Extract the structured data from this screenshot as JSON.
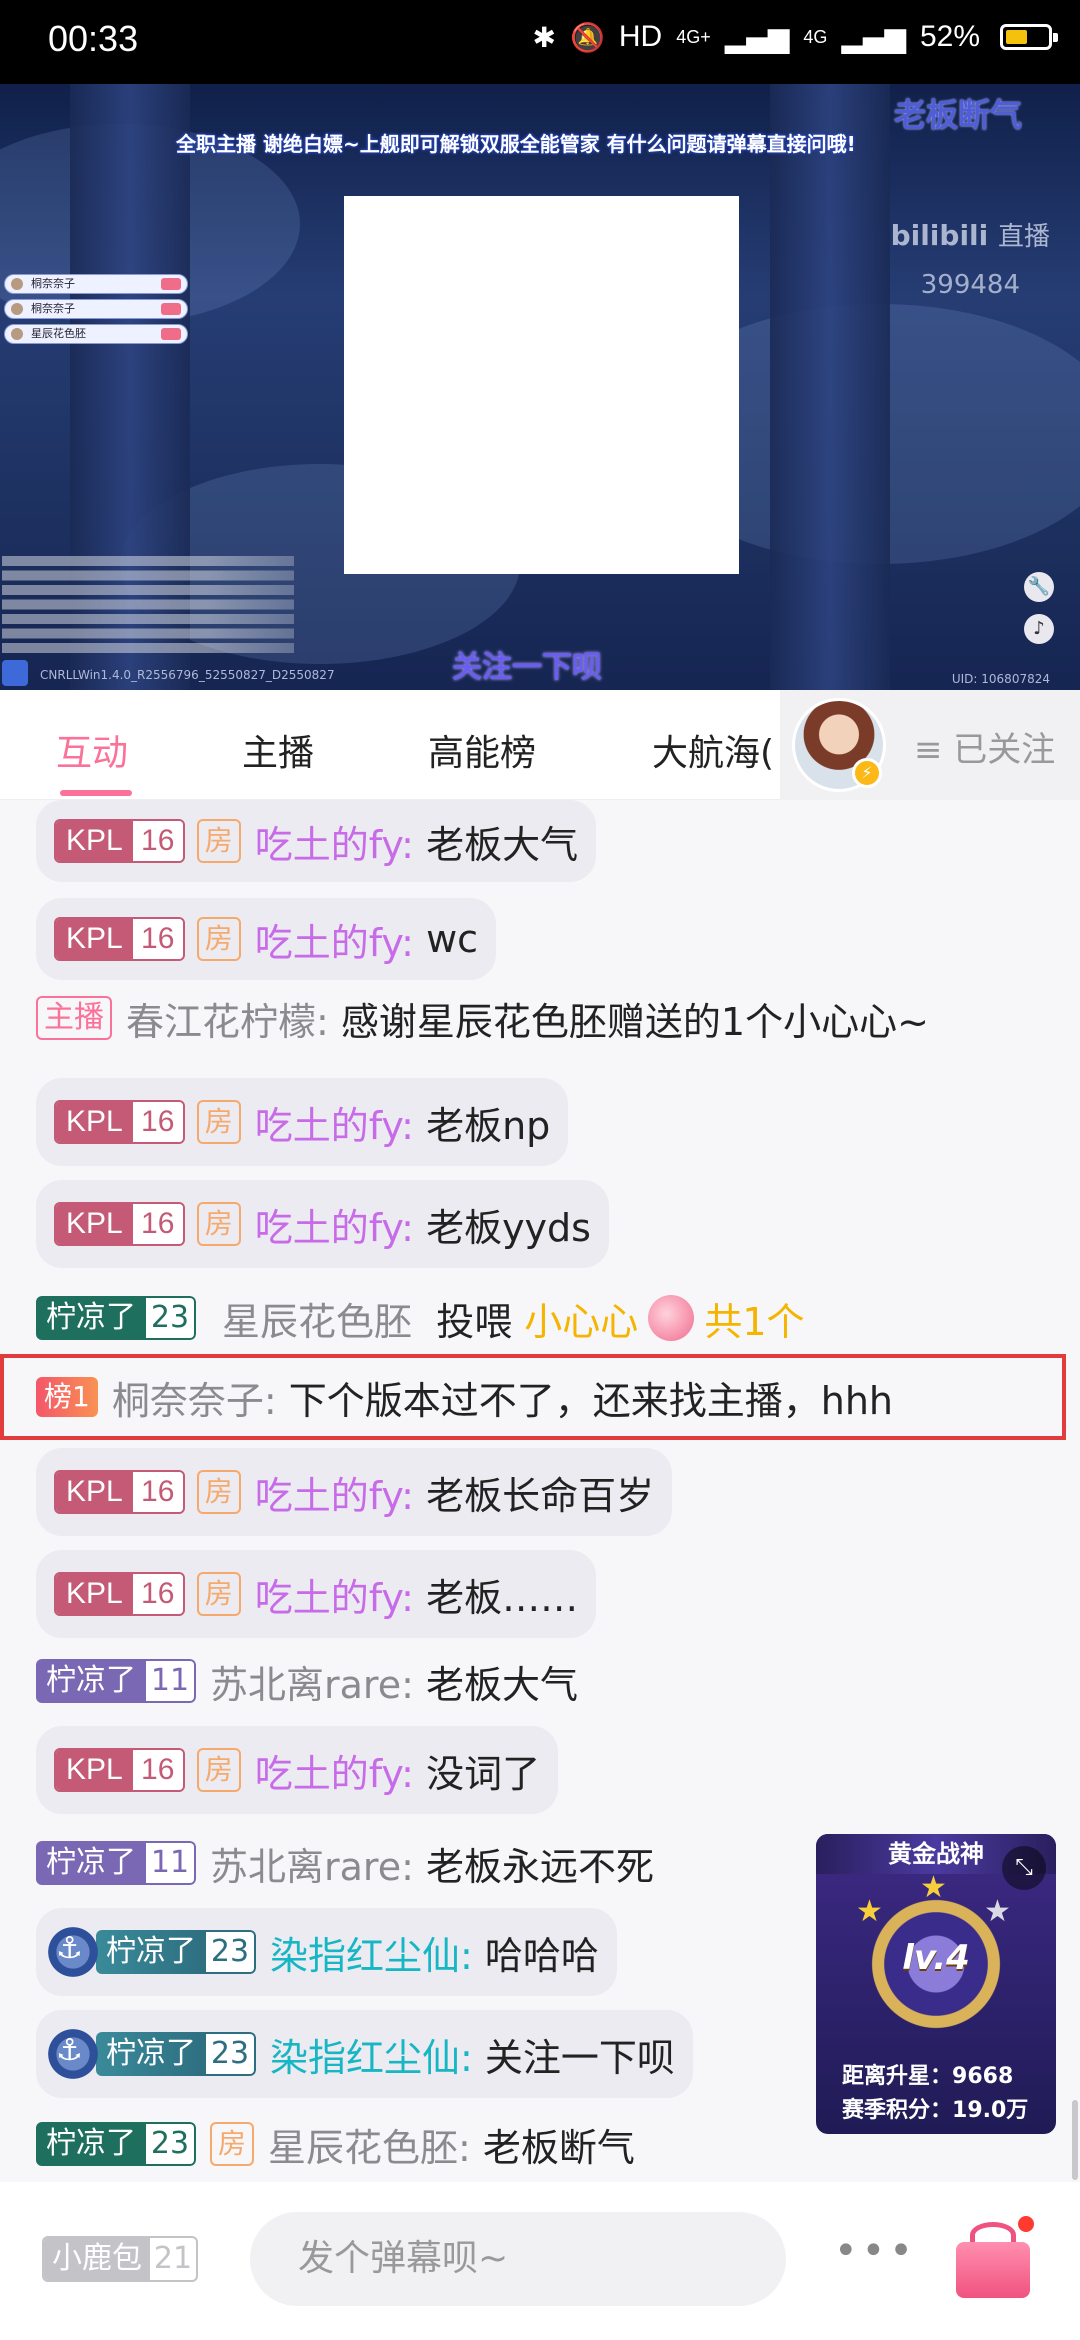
{
  "status_bar": {
    "time": "00:33",
    "network": "4G+",
    "network2": "4G",
    "battery": "52%",
    "battery_level": 0.52
  },
  "video": {
    "banner": "全职主播  谢绝白嫖~上舰即可解锁双服全能管家  有什么问题请弹幕直接问哦!",
    "top_right_text": "老板断气",
    "platform_logo": "bilibili",
    "platform_suffix": "直播",
    "viewer_count": "399484",
    "gift_list": [
      "桐奈奈子",
      "桐奈奈子",
      "星辰花色胚"
    ],
    "follow_prompt": "关注一下呗",
    "build_info": "CNRLLWin1.4.0_R2556796_52550827_D2550827",
    "uid": "UID: 106807824"
  },
  "tabs": {
    "items": [
      "互动",
      "主播",
      "高能榜",
      "大航海("
    ],
    "active": "互动",
    "followed_label": "≡ 已关注"
  },
  "chat": {
    "messages": [
      {
        "medal": "KPL",
        "level": "16",
        "room": "房",
        "user": "吃土的fy:",
        "text": "老板大气"
      },
      {
        "medal": "KPL",
        "level": "16",
        "room": "房",
        "user": "吃土的fy:",
        "text": "wc"
      },
      {
        "tag": "主播",
        "user": "春江花柠檬:",
        "text": "感谢星辰花色胚赠送的1个小心心~"
      },
      {
        "medal": "KPL",
        "level": "16",
        "room": "房",
        "user": "吃土的fy:",
        "text": "老板np"
      },
      {
        "medal": "KPL",
        "level": "16",
        "room": "房",
        "user": "吃土的fy:",
        "text": "老板yyds"
      },
      {
        "medal": "柠凉了",
        "level": "23",
        "user": "星辰花色胚",
        "action": "投喂",
        "gift": "小心心",
        "count": "共1个"
      },
      {
        "tag": "榜1",
        "user": "桐奈奈子:",
        "text": "下个版本过不了，还来找主播，hhh"
      },
      {
        "medal": "KPL",
        "level": "16",
        "room": "房",
        "user": "吃土的fy:",
        "text": "老板长命百岁"
      },
      {
        "medal": "KPL",
        "level": "16",
        "room": "房",
        "user": "吃土的fy:",
        "text": "老板……"
      },
      {
        "medal": "柠凉了",
        "level": "11",
        "user": "苏北离rare:",
        "text": "老板大气"
      },
      {
        "medal": "KPL",
        "level": "16",
        "room": "房",
        "user": "吃土的fy:",
        "text": "没词了"
      },
      {
        "medal": "柠凉了",
        "level": "11",
        "user": "苏北离rare:",
        "text": "老板永远不死"
      },
      {
        "medal": "柠凉了",
        "level": "23",
        "user": "染指红尘仙:",
        "text": "哈哈哈"
      },
      {
        "medal": "柠凉了",
        "level": "23",
        "user": "染指红尘仙:",
        "text": "关注一下呗"
      },
      {
        "medal": "柠凉了",
        "level": "23",
        "room": "房",
        "user": "星辰花色胚:",
        "text": "老板断气"
      }
    ]
  },
  "rank_card": {
    "title": "黄金战神",
    "level": "lv.4",
    "promo_label": "距离升星：",
    "promo_value": "9668",
    "points_label": "赛季积分：",
    "points_value": "19.0万"
  },
  "bottom_bar": {
    "medal": "小鹿包",
    "medal_level": "21",
    "input_placeholder": "发个弹幕呗~",
    "more": "•••"
  },
  "colors": {
    "accent": "#fb7299",
    "kpl": "#c45a75",
    "highlight_border": "#e13b3b",
    "gift_gold": "#f5b400"
  }
}
